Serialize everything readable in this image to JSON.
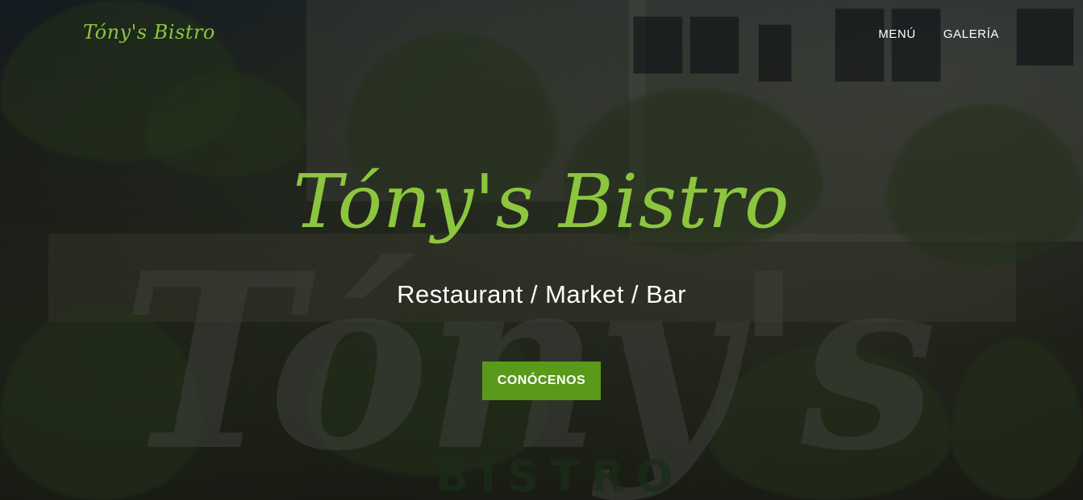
{
  "nav": {
    "brand": "Tóny's Bistro",
    "items": [
      {
        "label": "MENÚ"
      },
      {
        "label": "GALERÍA"
      }
    ]
  },
  "hero": {
    "title": "Tóny's Bistro",
    "subtitle": "Restaurant / Market / Bar",
    "cta_label": "CONÓCENOS",
    "background": {
      "sign_text": "Tóny's",
      "sign_subtext": "BISTRO"
    }
  },
  "colors": {
    "accent": "#8cc63f",
    "button": "#5a9a1a",
    "text": "#ffffff"
  }
}
